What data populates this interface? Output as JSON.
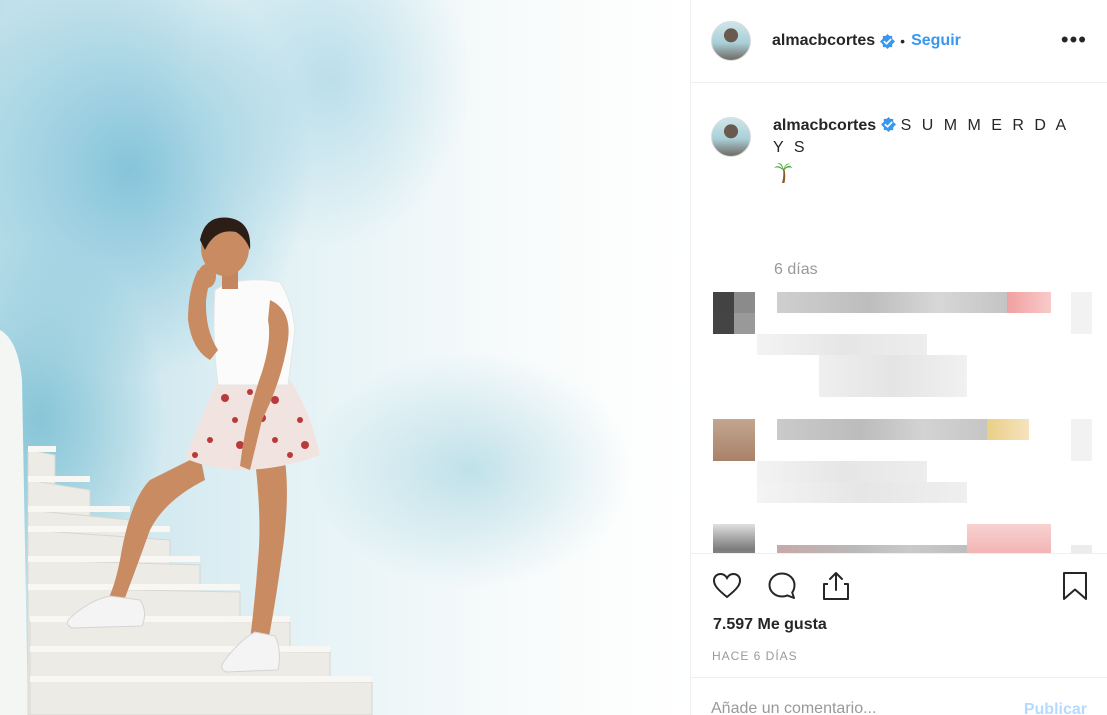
{
  "post": {
    "username": "almacbcortes",
    "follow_label": "Seguir",
    "separator": "•",
    "more_label": "•••",
    "caption": "S U M M E R D A Y S",
    "caption_emoji": "palm-tree",
    "caption_time": "6 días",
    "likes_text": "7.597 Me gusta",
    "posted_ago": "HACE 6 DÍAS",
    "comment_placeholder": "Añade un comentario...",
    "publish_label": "Publicar"
  },
  "colors": {
    "link_blue": "#3897f0",
    "verified_blue": "#3897f0",
    "publish_disabled": "#b3dbff",
    "muted": "#999999",
    "text": "#262626",
    "border": "#efefef"
  },
  "icons": [
    "verified-badge-icon",
    "more-options-icon",
    "heart-icon",
    "comment-icon",
    "share-icon",
    "bookmark-icon",
    "palm-tree-icon"
  ]
}
